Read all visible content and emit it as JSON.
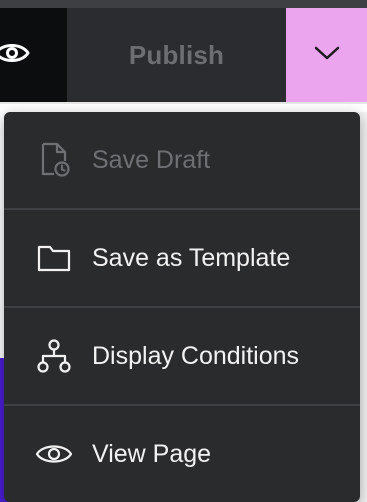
{
  "toolbar": {
    "publish_label": "Publish",
    "preview_icon": "eye-icon",
    "more_icon": "chevron-down-icon",
    "accent_color": "#eaa5ee"
  },
  "menu": {
    "items": [
      {
        "label": "Save Draft",
        "icon": "document-clock-icon",
        "enabled": false
      },
      {
        "label": "Save as Template",
        "icon": "folder-icon",
        "enabled": true
      },
      {
        "label": "Display Conditions",
        "icon": "hierarchy-icon",
        "enabled": true
      },
      {
        "label": "View Page",
        "icon": "eye-icon",
        "enabled": true
      }
    ]
  }
}
